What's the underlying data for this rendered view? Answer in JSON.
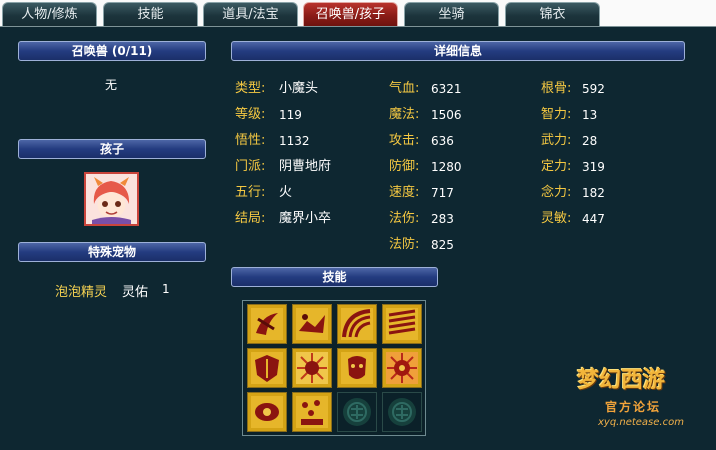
{
  "tabs": [
    {
      "label": "人物/修炼",
      "active": false
    },
    {
      "label": "技能",
      "active": false
    },
    {
      "label": "道具/法宝",
      "active": false
    },
    {
      "label": "召唤兽/孩子",
      "active": true
    },
    {
      "label": "坐骑",
      "active": false
    },
    {
      "label": "锦衣",
      "active": false
    }
  ],
  "left": {
    "summon_header": "召唤兽 (0/11)",
    "summon_empty": "无",
    "child_header": "孩子",
    "special_header": "特殊宠物",
    "special_pet": {
      "name": "泡泡精灵",
      "skill": "灵佑",
      "count": "1"
    }
  },
  "detail": {
    "header": "详细信息",
    "col1": [
      {
        "label": "类型:",
        "value": "小魔头"
      },
      {
        "label": "等级:",
        "value": "119"
      },
      {
        "label": "悟性:",
        "value": "1132"
      },
      {
        "label": "门派:",
        "value": "阴曹地府"
      },
      {
        "label": "五行:",
        "value": "火"
      },
      {
        "label": "结局:",
        "value": "魔界小卒"
      }
    ],
    "col2": [
      {
        "label": "气血:",
        "value": "6321"
      },
      {
        "label": "魔法:",
        "value": "1506"
      },
      {
        "label": "攻击:",
        "value": "636"
      },
      {
        "label": "防御:",
        "value": "1280"
      },
      {
        "label": "速度:",
        "value": "717"
      },
      {
        "label": "法伤:",
        "value": "283"
      },
      {
        "label": "法防:",
        "value": "825"
      }
    ],
    "col3": [
      {
        "label": "根骨:",
        "value": "592"
      },
      {
        "label": "智力:",
        "value": "13"
      },
      {
        "label": "武力:",
        "value": "28"
      },
      {
        "label": "定力:",
        "value": "319"
      },
      {
        "label": "念力:",
        "value": "182"
      },
      {
        "label": "灵敏:",
        "value": "447"
      }
    ]
  },
  "skills": {
    "header": "技能",
    "icons": [
      "skill-icon-1",
      "skill-icon-2",
      "skill-icon-3",
      "skill-icon-4",
      "skill-icon-5",
      "skill-icon-6",
      "skill-icon-7",
      "skill-icon-8",
      "skill-icon-9",
      "skill-icon-10",
      "empty-slot-icon",
      "empty-slot-icon"
    ]
  },
  "watermark": {
    "logo": "梦幻西游",
    "sub": "官方论坛",
    "url": "xyq.netease.com"
  }
}
